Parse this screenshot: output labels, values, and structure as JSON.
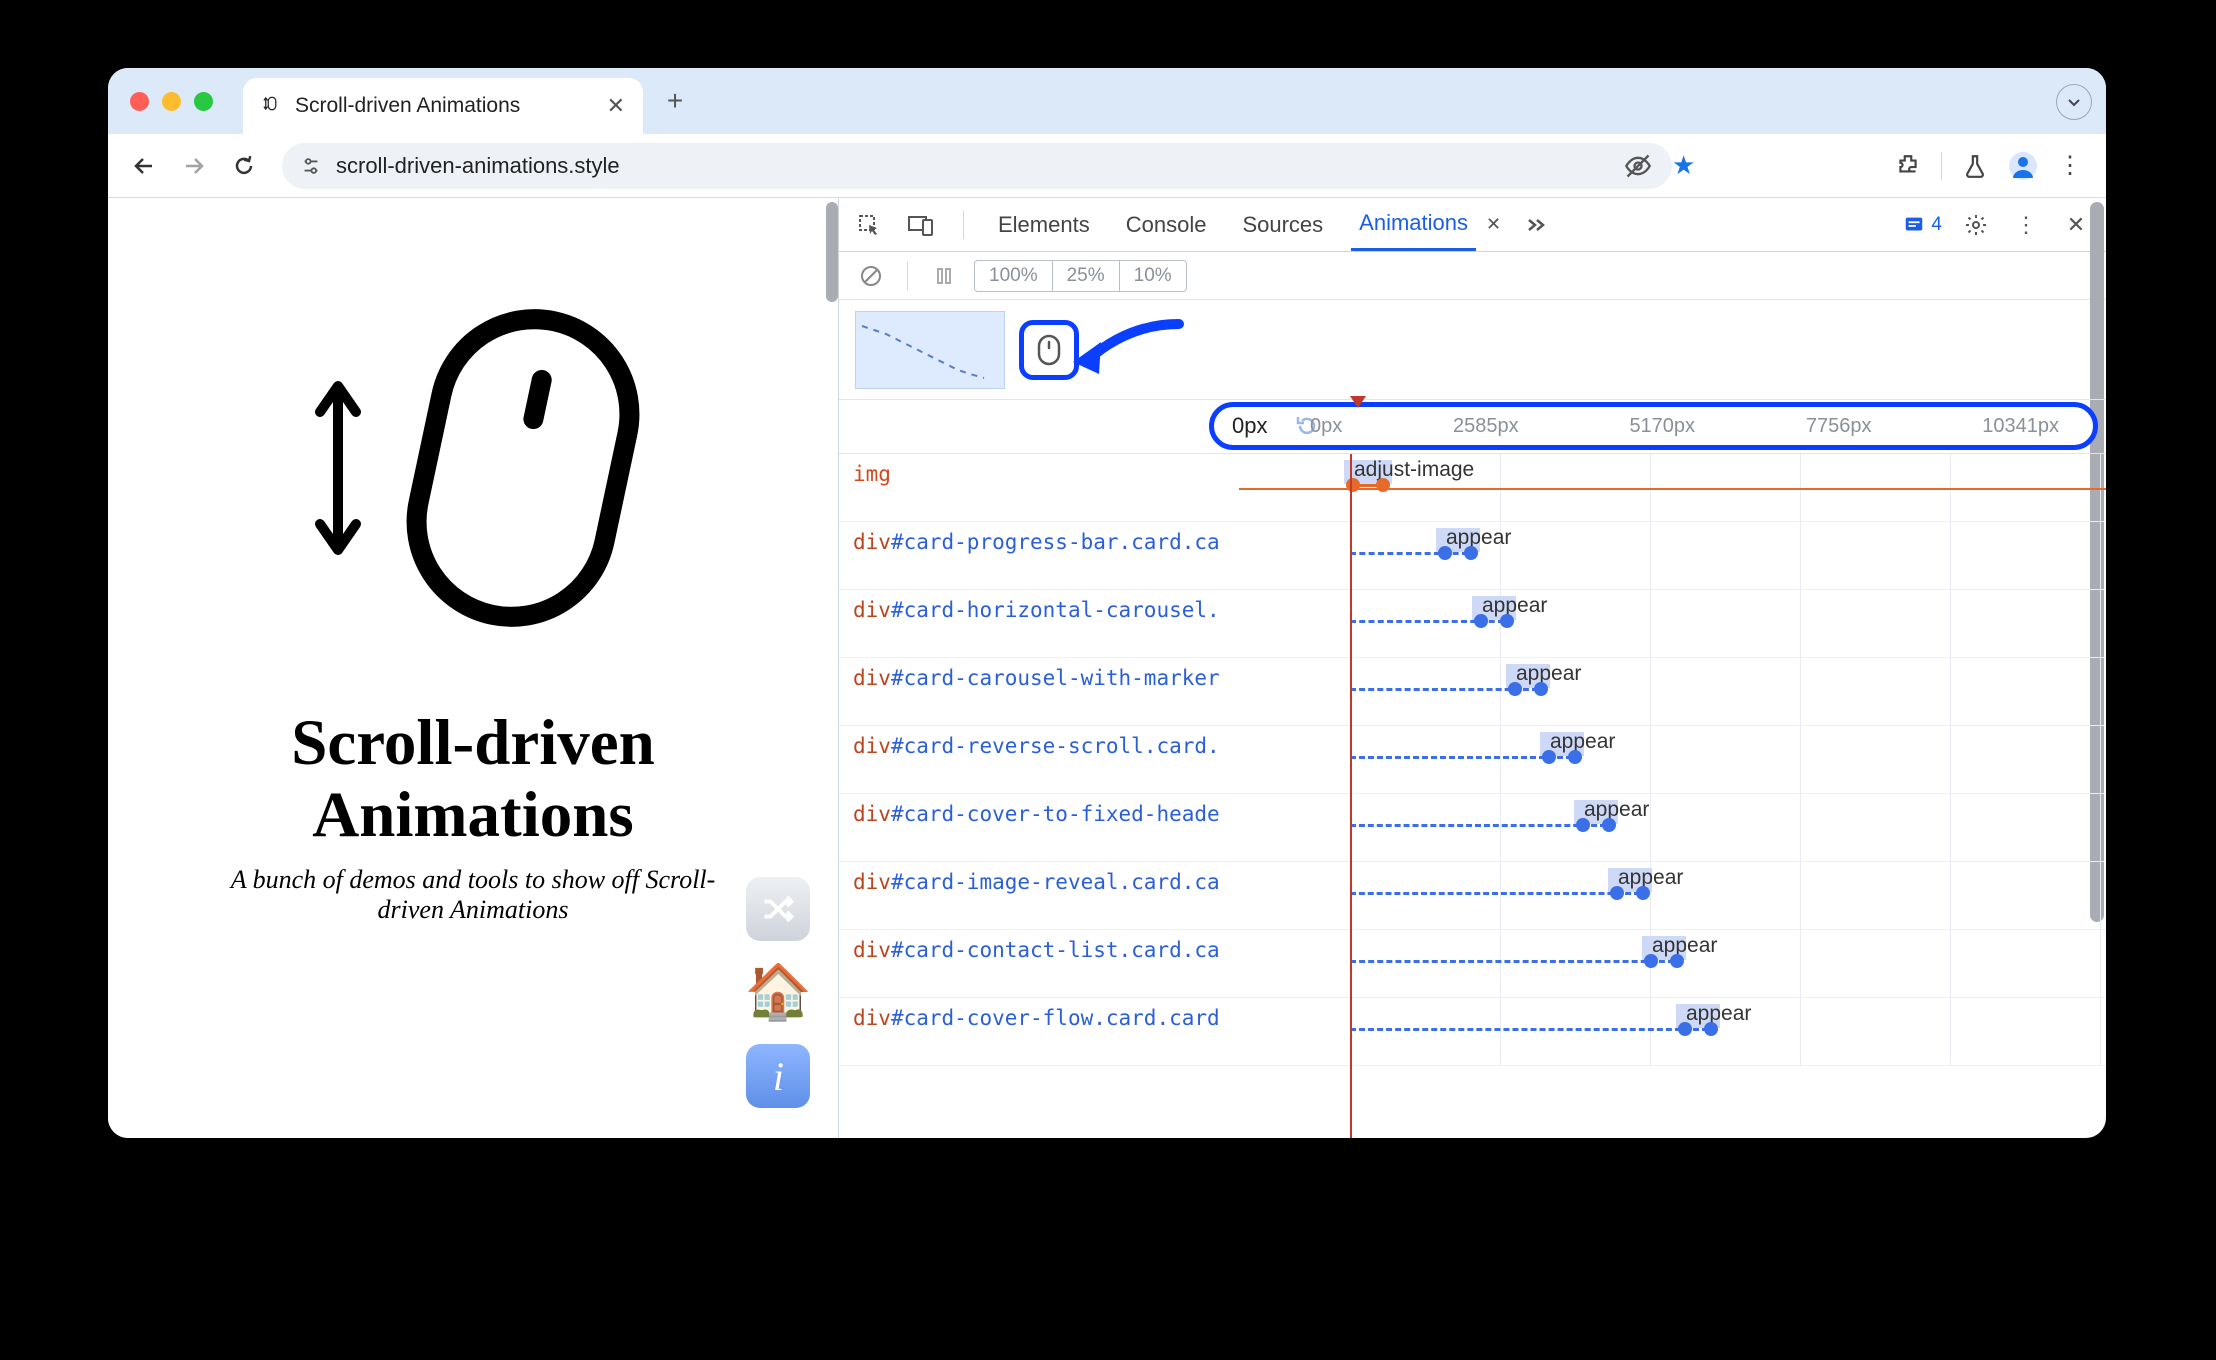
{
  "browser": {
    "tab_title": "Scroll-driven Animations",
    "url": "scroll-driven-animations.style",
    "actions": {
      "back": "←",
      "forward": "→",
      "reload": "⟳"
    }
  },
  "page": {
    "heading_l1": "Scroll-driven",
    "heading_l2": "Animations",
    "subtitle": "A bunch of demos and tools to show off Scroll-driven Animations"
  },
  "devtools": {
    "tabs": [
      "Elements",
      "Console",
      "Sources",
      "Animations"
    ],
    "active_tab": "Animations",
    "issues_count": "4",
    "speed_options": [
      "100%",
      "25%",
      "10%"
    ],
    "ruler": {
      "current": "0px",
      "ticks": [
        "0px",
        "2585px",
        "5170px",
        "7756px",
        "10341px"
      ]
    },
    "tracks": [
      {
        "tag": "img",
        "id": "",
        "cls": "",
        "anim": "adjust-image",
        "offset": 0,
        "seg": 30
      },
      {
        "tag": "div",
        "id": "#card-progress-bar",
        "cls": ".card.ca",
        "anim": "appear",
        "offset": 92,
        "seg": 26
      },
      {
        "tag": "div",
        "id": "#card-horizontal-carousel",
        "cls": ".",
        "anim": "appear",
        "offset": 128,
        "seg": 26
      },
      {
        "tag": "div",
        "id": "#card-carousel-with-marker",
        "cls": "",
        "anim": "appear",
        "offset": 162,
        "seg": 26
      },
      {
        "tag": "div",
        "id": "#card-reverse-scroll",
        "cls": ".card.",
        "anim": "appear",
        "offset": 196,
        "seg": 26
      },
      {
        "tag": "div",
        "id": "#card-cover-to-fixed-heade",
        "cls": "",
        "anim": "appear",
        "offset": 230,
        "seg": 26
      },
      {
        "tag": "div",
        "id": "#card-image-reveal",
        "cls": ".card.ca",
        "anim": "appear",
        "offset": 264,
        "seg": 26
      },
      {
        "tag": "div",
        "id": "#card-contact-list",
        "cls": ".card.ca",
        "anim": "appear",
        "offset": 298,
        "seg": 26
      },
      {
        "tag": "div",
        "id": "#card-cover-flow",
        "cls": ".card.card",
        "anim": "appear",
        "offset": 332,
        "seg": 26
      }
    ]
  }
}
